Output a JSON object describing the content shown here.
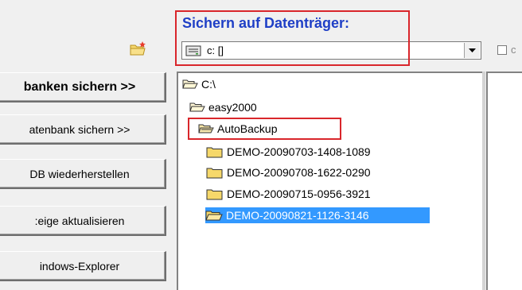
{
  "left_buttons": [
    {
      "label": "banken sichern >>"
    },
    {
      "label": "atenbank sichern >>"
    },
    {
      "label": "DB wiederherstellen"
    },
    {
      "label": ":eige aktualisieren"
    },
    {
      "label": "indows-Explorer"
    }
  ],
  "backup_target": {
    "title": "Sichern auf Datenträger:",
    "drive_value": "c: []",
    "drive_icon": "drive-icon"
  },
  "tree": {
    "nodes": [
      {
        "label": "C:\\",
        "icon": "folder-open-icon"
      },
      {
        "label": "easy2000",
        "icon": "folder-open-icon"
      },
      {
        "label": "AutoBackup",
        "icon": "folder-open-icon"
      },
      {
        "label": "DEMO-20090703-1408-1089",
        "icon": "folder-icon"
      },
      {
        "label": "DEMO-20090708-1622-0290",
        "icon": "folder-icon"
      },
      {
        "label": "DEMO-20090715-0956-3921",
        "icon": "folder-icon"
      },
      {
        "label": "DEMO-20090821-1126-3146",
        "icon": "folder-open-icon",
        "selected": true
      }
    ]
  },
  "colors": {
    "title": "#1f3fc6",
    "highlight_box": "#d9262b",
    "selection": "#3399ff"
  }
}
